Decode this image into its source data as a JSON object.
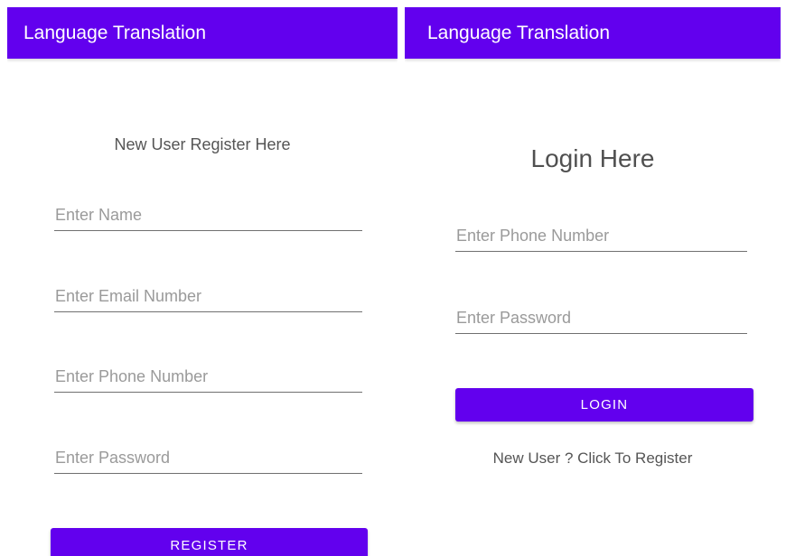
{
  "register_screen": {
    "app_title": "Language Translation",
    "heading": "New User Register Here",
    "fields": {
      "name_placeholder": "Enter Name",
      "email_placeholder": "Enter Email Number",
      "phone_placeholder": "Enter Phone Number",
      "password_placeholder": "Enter Password"
    },
    "register_button": "REGISTER"
  },
  "login_screen": {
    "app_title": "Language Translation",
    "heading": "Login Here",
    "fields": {
      "phone_placeholder": "Enter Phone Number",
      "password_placeholder": "Enter Password"
    },
    "login_button": "LOGIN",
    "register_link": "New User ? Click To Register"
  },
  "colors": {
    "primary": "#6200ee",
    "on_primary": "#ffffff",
    "text": "#555555",
    "hint": "#9a9a9a",
    "underline": "#707070"
  }
}
